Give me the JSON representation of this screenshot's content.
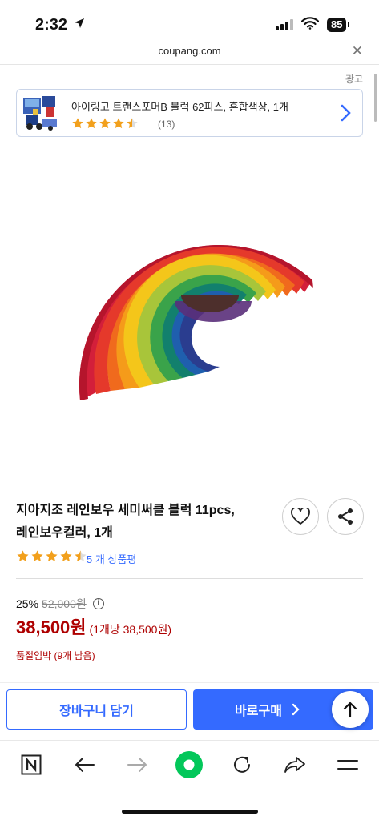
{
  "status": {
    "time": "2:32",
    "battery": "85"
  },
  "browser": {
    "url": "coupang.com"
  },
  "ad": {
    "label": "광고",
    "title": "아이링고 트랜스포머B 블럭 62피스, 혼합색상, 1개",
    "rating": 4.5,
    "review_count": "(13)"
  },
  "product": {
    "name_line1": "지아지조 레인보우 세미써클 블럭 11pcs,",
    "name_line2": "레인보우컬러, 1개",
    "rating": 4.5,
    "review_link": "5 개 상품평",
    "discount_pct": "25%",
    "original_price": "52,000원",
    "price": "38,500원",
    "unit_price": "(1개당 38,500원)",
    "stock_note": "품절임박 (9개 남음)"
  },
  "actions": {
    "cart_label": "장바구니 담기",
    "buy_label": "바로구매"
  },
  "colors": {
    "accent": "#346aff",
    "price_red": "#ae0000",
    "star": "#f2a01c"
  },
  "icons": {
    "toolbar": [
      "naver-n-icon",
      "back-arrow-icon",
      "forward-arrow-icon",
      "green-dot-icon",
      "reload-icon",
      "share-arrow-icon",
      "menu-icon"
    ]
  }
}
